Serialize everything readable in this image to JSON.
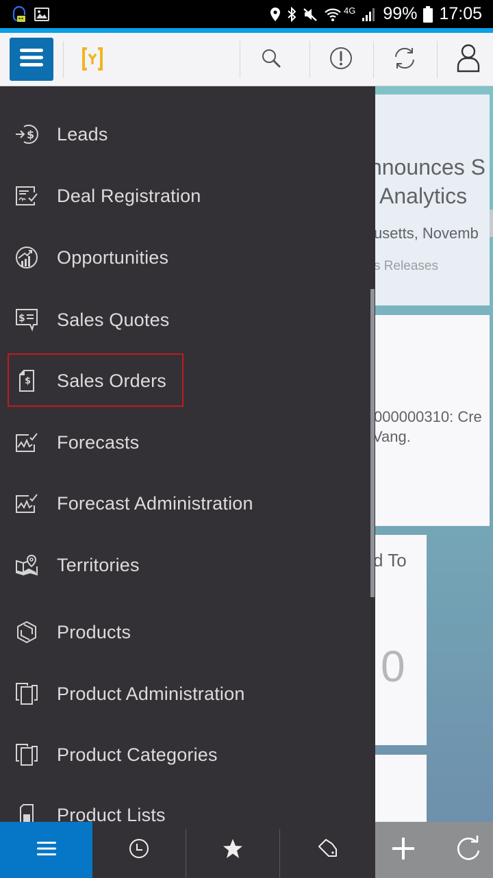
{
  "status_bar": {
    "left_icons": [
      "headset-notification-icon",
      "image-icon"
    ],
    "right_icons": [
      "location-icon",
      "bluetooth-icon",
      "mute-icon",
      "wifi-icon",
      "signal-icon",
      "battery-icon"
    ],
    "network": "4G",
    "battery": "99%",
    "time": "17:05"
  },
  "header": {
    "menu_icon": "hamburger-icon",
    "logo": "app-logo",
    "actions": [
      {
        "name": "search",
        "icon": "search-icon"
      },
      {
        "name": "alerts",
        "icon": "alert-icon"
      },
      {
        "name": "sync",
        "icon": "sync-icon"
      },
      {
        "name": "profile",
        "icon": "user-icon"
      }
    ],
    "colors": {
      "menu_button": "#0e6fb0",
      "logo": "#f2b51e",
      "accent_strip": "#0aa0e6"
    }
  },
  "drawer": {
    "items": [
      {
        "label": "Leads",
        "icon": "leads-icon"
      },
      {
        "label": "Deal Registration",
        "icon": "deal-registration-icon"
      },
      {
        "label": "Opportunities",
        "icon": "opportunities-icon"
      },
      {
        "label": "Sales Quotes",
        "icon": "sales-quotes-icon"
      },
      {
        "label": "Sales Orders",
        "icon": "sales-orders-icon",
        "highlighted": true
      },
      {
        "label": "Forecasts",
        "icon": "forecasts-icon"
      },
      {
        "label": "Forecast Administration",
        "icon": "forecast-administration-icon"
      },
      {
        "label": "Territories",
        "icon": "territories-icon"
      },
      {
        "label": "Products",
        "icon": "products-icon"
      },
      {
        "label": "Product Administration",
        "icon": "product-administration-icon"
      },
      {
        "label": "Product Categories",
        "icon": "product-categories-icon"
      },
      {
        "label": "Product Lists",
        "icon": "product-lists-icon"
      }
    ],
    "highlight_color": "#c4191f"
  },
  "background": {
    "card1": {
      "line1": "nnounces S",
      "line2": ", Analytics",
      "line3": "usetts, Novemb",
      "line4": "s Releases"
    },
    "card2": {
      "line1": "000000310: Cre",
      "line2": "Vang."
    },
    "card3": {
      "label": "d To",
      "value": "0"
    }
  },
  "bottom_bar": {
    "tabs": [
      {
        "name": "menu",
        "icon": "hamburger-icon",
        "active": true
      },
      {
        "name": "recent",
        "icon": "clock-icon"
      },
      {
        "name": "favorites",
        "icon": "star-icon"
      },
      {
        "name": "tags",
        "icon": "tag-icon"
      }
    ],
    "actions": [
      {
        "name": "add",
        "icon": "plus-icon"
      },
      {
        "name": "refresh",
        "icon": "refresh-icon"
      }
    ]
  }
}
